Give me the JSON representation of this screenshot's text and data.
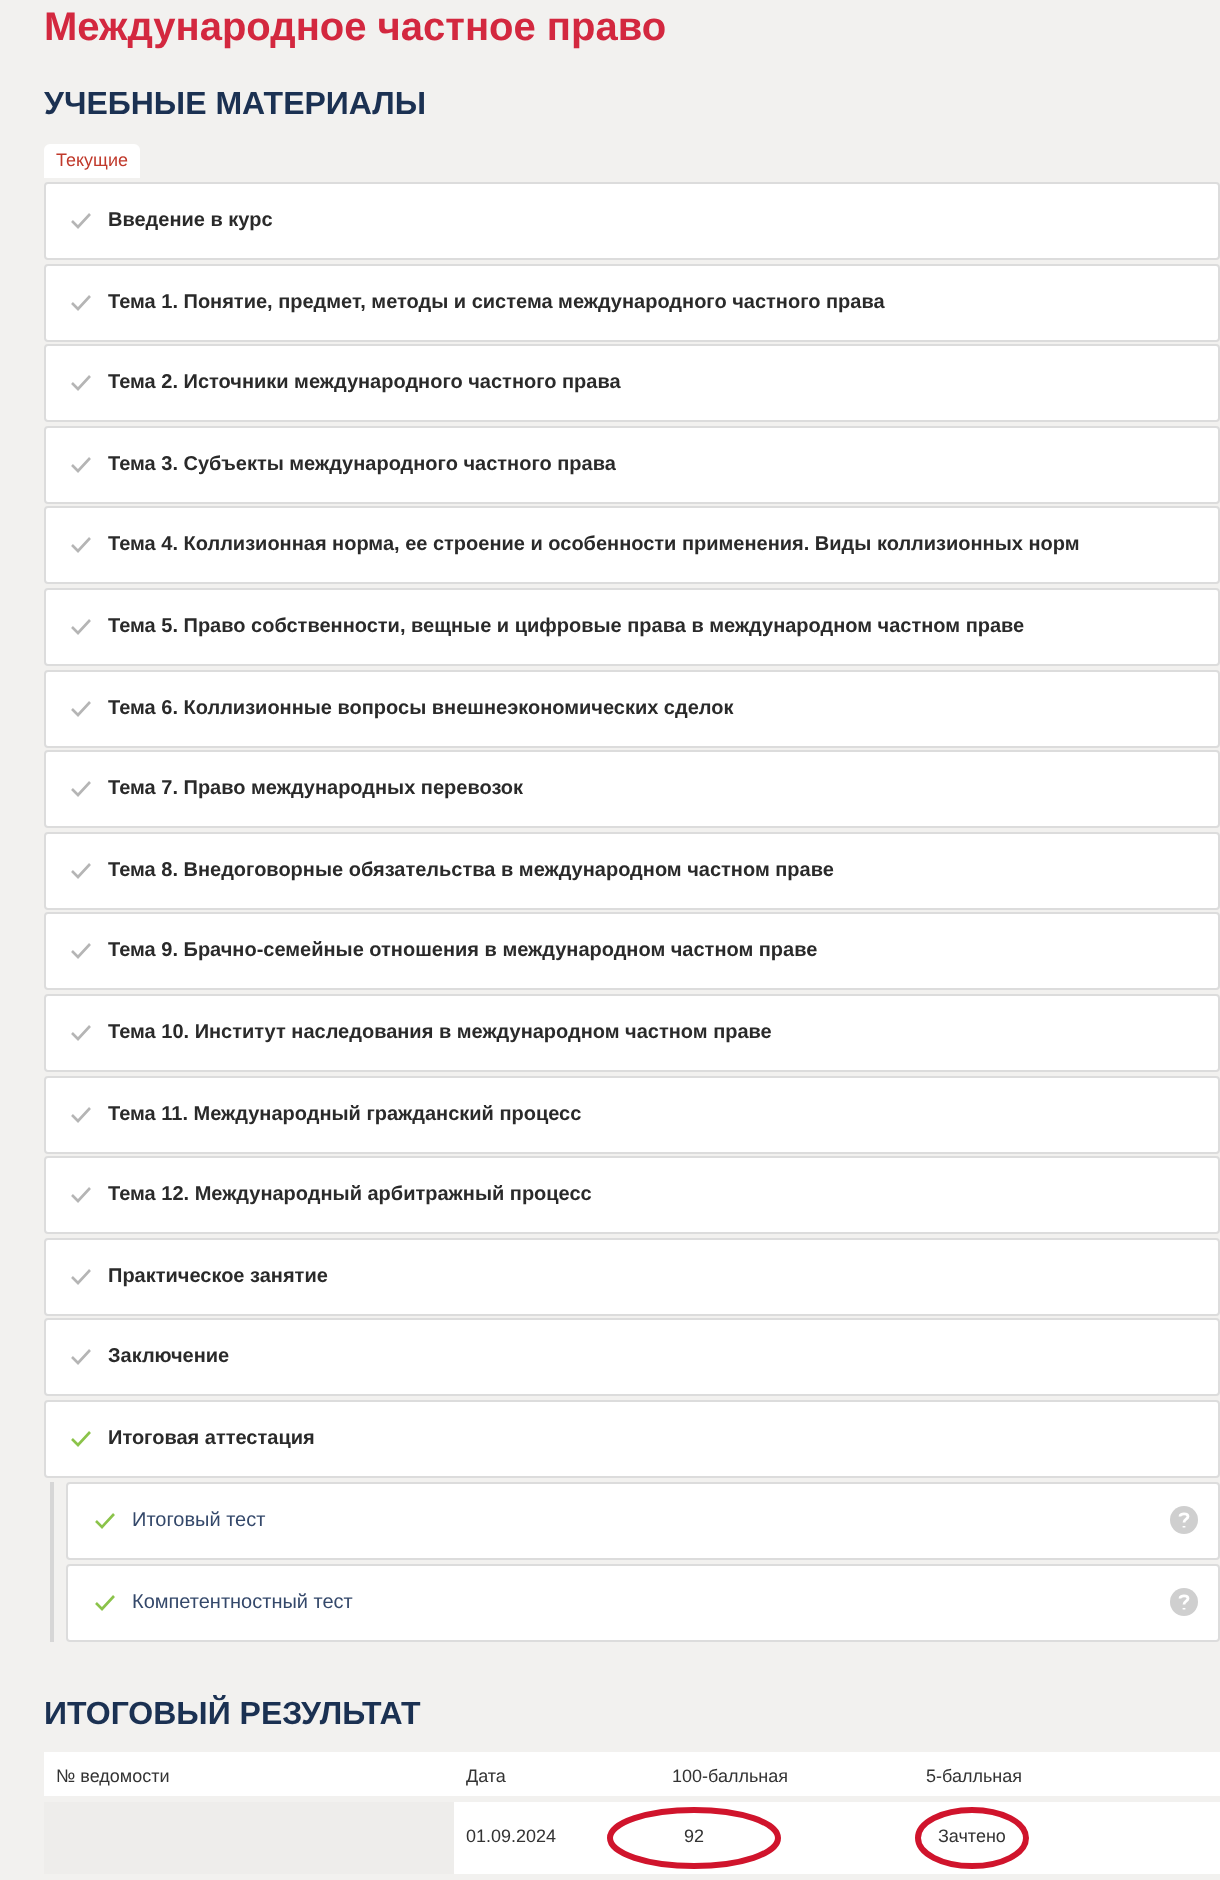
{
  "title": "Международное частное право",
  "materials": {
    "heading": "УЧЕБНЫЕ МАТЕРИАЛЫ",
    "tabs": [
      {
        "label": "Текущие",
        "selected": true
      }
    ],
    "items": [
      {
        "label": "Введение в курс",
        "done": false
      },
      {
        "label": "Тема 1. Понятие, предмет, методы и система международного частного права",
        "done": false
      },
      {
        "label": "Тема 2. Источники международного частного права",
        "done": false
      },
      {
        "label": "Тема 3. Субъекты международного частного права",
        "done": false
      },
      {
        "label": "Тема 4. Коллизионная норма, ее строение и особенности применения. Виды коллизионных норм",
        "done": false
      },
      {
        "label": "Тема 5. Право собственности, вещные и цифровые права в международном частном праве",
        "done": false
      },
      {
        "label": "Тема 6. Коллизионные вопросы внешнеэкономических сделок",
        "done": false
      },
      {
        "label": "Тема 7. Право международных перевозок",
        "done": false
      },
      {
        "label": "Тема 8. Внедоговорные обязательства в международном частном праве",
        "done": false
      },
      {
        "label": "Тема 9. Брачно-семейные отношения в международном частном праве",
        "done": false
      },
      {
        "label": "Тема 10. Институт наследования в международном частном праве",
        "done": false
      },
      {
        "label": "Тема 11. Международный гражданский процесс",
        "done": false
      },
      {
        "label": "Тема 12. Международный арбитражный процесс",
        "done": false
      },
      {
        "label": "Практическое занятие",
        "done": false
      },
      {
        "label": "Заключение",
        "done": false
      },
      {
        "label": "Итоговая аттестация",
        "done": true,
        "children": [
          {
            "label": "Итоговый тест",
            "done": true
          },
          {
            "label": "Компетентностный тест",
            "done": true
          }
        ]
      }
    ]
  },
  "result": {
    "heading": "ИТОГОВЫЙ РЕЗУЛЬТАТ",
    "columns": [
      "№ ведомости",
      "Дата",
      "100-балльная",
      "5-балльная"
    ],
    "rows": [
      {
        "cells": [
          {
            "redacted": true
          },
          {
            "text": "01.09.2024",
            "circled": false
          },
          {
            "text": "92",
            "circled": true
          },
          {
            "text": "Зачтено",
            "circled": true
          }
        ]
      }
    ]
  }
}
